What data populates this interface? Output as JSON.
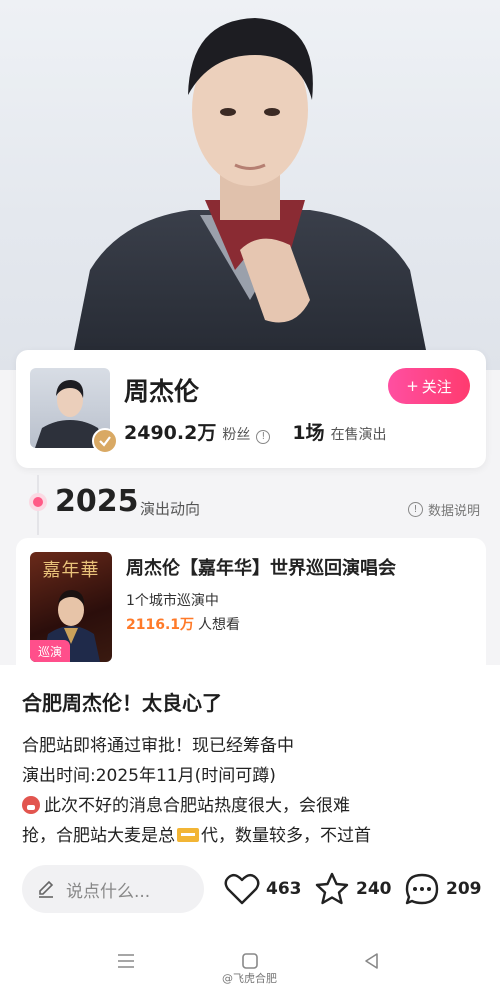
{
  "artist": {
    "name": "周杰伦",
    "follow_label": "关注",
    "fans_count": "2490.2万",
    "fans_label": "粉丝",
    "shows_count": "1场",
    "shows_label": "在售演出"
  },
  "timeline": {
    "year": "2025",
    "section_label": "演出动向",
    "data_note": "数据说明"
  },
  "concert": {
    "poster_text": "嘉年華",
    "tag": "巡演",
    "title": "周杰伦【嘉年华】世界巡回演唱会",
    "cities": "1个城市巡演中",
    "want_count": "2116.1万",
    "want_label": "人想看"
  },
  "post": {
    "title": "合肥周杰伦！太良心了",
    "line1": "合肥站即将通过审批！现已经筹备中",
    "line2": "演出时间:2025年11月(时间可蹲)",
    "line3": "此次不好的消息合肥站热度很大，会很难",
    "line4a": "抢，合肥站大麦是总",
    "line4b": "代，数量较多，不过首",
    "comment_placeholder": "说点什么...",
    "likes": "463",
    "favorites": "240",
    "comments": "209"
  },
  "watermark": "@飞虎合肥",
  "colors": {
    "accent_pink": "#ff3b6f",
    "want_orange": "#ff7a29"
  }
}
